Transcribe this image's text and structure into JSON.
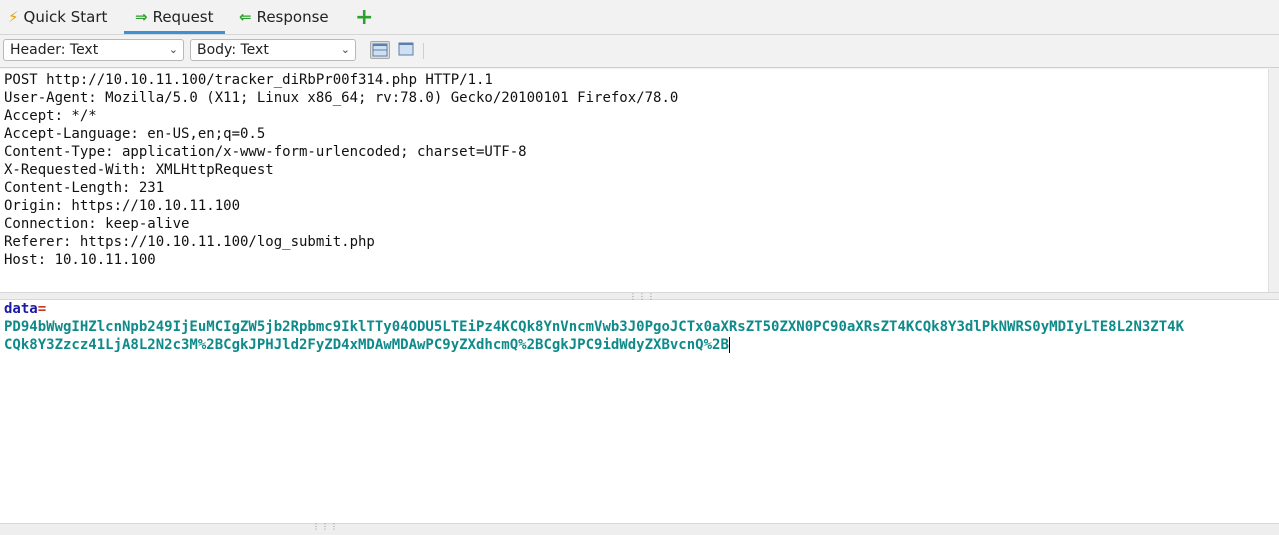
{
  "tabs": {
    "quick_start": {
      "label": "Quick Start",
      "icon": "lightning-icon"
    },
    "request": {
      "label": "Request",
      "icon": "arrow-right-icon",
      "active": true
    },
    "response": {
      "label": "Response",
      "icon": "arrow-left-icon"
    },
    "add": {
      "label": "+",
      "icon": "plus-icon"
    }
  },
  "toolbar": {
    "header_view": {
      "selected": "Header: Text"
    },
    "body_view": {
      "selected": "Body: Text"
    },
    "layout_buttons": [
      "horizontal-split-icon",
      "vertical-split-icon"
    ]
  },
  "request_headers": [
    "POST http://10.10.11.100/tracker_diRbPr00f314.php HTTP/1.1",
    "User-Agent: Mozilla/5.0 (X11; Linux x86_64; rv:78.0) Gecko/20100101 Firefox/78.0",
    "Accept: */*",
    "Accept-Language: en-US,en;q=0.5",
    "Content-Type: application/x-www-form-urlencoded; charset=UTF-8",
    "X-Requested-With: XMLHttpRequest",
    "Content-Length: 231",
    "Origin: https://10.10.11.100",
    "Connection: keep-alive",
    "Referer: https://10.10.11.100/log_submit.php",
    "Host: 10.10.11.100"
  ],
  "request_body": {
    "param_name": "data",
    "equals": "=",
    "value_lines": [
      "PD94bWwgIHZlcnNpb249IjEuMCIgZW5jb2Rpbmc9IklTTy04ODU5LTEiPz4KCQk8YnVncmVwb3J0PgoJCTx0aXRsZT50ZXN0PC90aXRsZT4KCQk8Y3dlPkNWRS0yMDIyLTE8L2N3ZT4K",
      "CQk8Y3Zzcz41LjA8L2N2c3M%2BCgkJPHJld2FyZD4xMDAwMDAwPC9yZXdhcmQ%2BCgkJPC9idWdyZXBvcnQ%2B"
    ]
  },
  "colors": {
    "param_name": "#1a1aa6",
    "param_value": "#0e8a8a",
    "equals": "#c0392b",
    "active_tab_underline": "#3d8fd6",
    "add_tab": "#2ea02e"
  }
}
